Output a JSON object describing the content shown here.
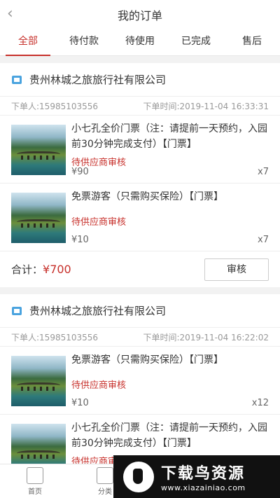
{
  "header": {
    "title": "我的订单"
  },
  "tabs": [
    "全部",
    "待付款",
    "待使用",
    "已完成",
    "售后"
  ],
  "orders": [
    {
      "shop": "贵州林城之旅旅行社有限公司",
      "buyer": "下单人:15985103556",
      "time": "下单时间:2019-11-04 16:33:31",
      "items": [
        {
          "name": "小七孔全价门票（注：请提前一天预约，入园前30分钟完成支付）【门票】",
          "status": "待供应商审核",
          "price": "¥90",
          "qty": "x7"
        },
        {
          "name": "免票游客（只需购买保险）【门票】",
          "status": "待供应商审核",
          "price": "¥10",
          "qty": "x7"
        }
      ],
      "total_label": "合计：",
      "total_value": "¥700",
      "action": "审核"
    },
    {
      "shop": "贵州林城之旅旅行社有限公司",
      "buyer": "下单人:15985103556",
      "time": "下单时间:2019-11-04 16:22:02",
      "items": [
        {
          "name": "免票游客（只需购买保险）【门票】",
          "status": "待供应商审核",
          "price": "¥10",
          "qty": "x12"
        },
        {
          "name": "小七孔全价门票（注：请提前一天预约，入园前30分钟完成支付）【门票】",
          "status": "待供应商审核",
          "price": "",
          "qty": ""
        }
      ]
    }
  ],
  "bottom_nav": [
    "首页",
    "分类"
  ],
  "watermark": {
    "title": "下载鸟资源",
    "url": "www.xiazainiao.com"
  }
}
